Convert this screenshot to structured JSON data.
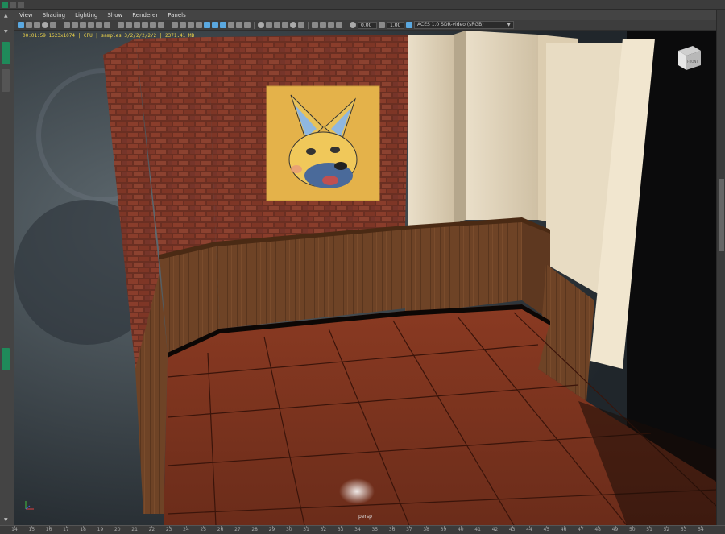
{
  "menubar": {
    "items": [
      "View",
      "Shading",
      "Lighting",
      "Show",
      "Renderer",
      "Panels"
    ]
  },
  "toolbar": {
    "exposure_value": "0.00",
    "gamma_value": "1.00",
    "colorspace": "ACES 1.0 SDR-video (sRGB)"
  },
  "viewport": {
    "hud": "00:01:59  1523x1074  |  CPU  |  samples 3/2/2/2/2/2  |  2371.41 MB",
    "camera_label": "persp",
    "view_cube_label": "FRONT"
  },
  "timeline": {
    "ticks": [
      "14",
      "15",
      "16",
      "17",
      "18",
      "19",
      "20",
      "21",
      "22",
      "23",
      "24",
      "25",
      "26",
      "27",
      "28",
      "29",
      "30",
      "31",
      "32",
      "33",
      "34",
      "35",
      "36",
      "37",
      "38",
      "39",
      "40",
      "41",
      "42",
      "43",
      "44",
      "45",
      "46",
      "47",
      "48",
      "49",
      "50",
      "51",
      "52",
      "53",
      "54"
    ]
  },
  "colors": {
    "hud_text": "#f0d64a",
    "accent_blue": "#5aa8e0",
    "shelf_green": "#1f8a5a"
  },
  "scene": {
    "poster": "cartoon fox portrait poster",
    "icons": [
      "axis-gizmo-icon",
      "view-cube-icon"
    ]
  }
}
